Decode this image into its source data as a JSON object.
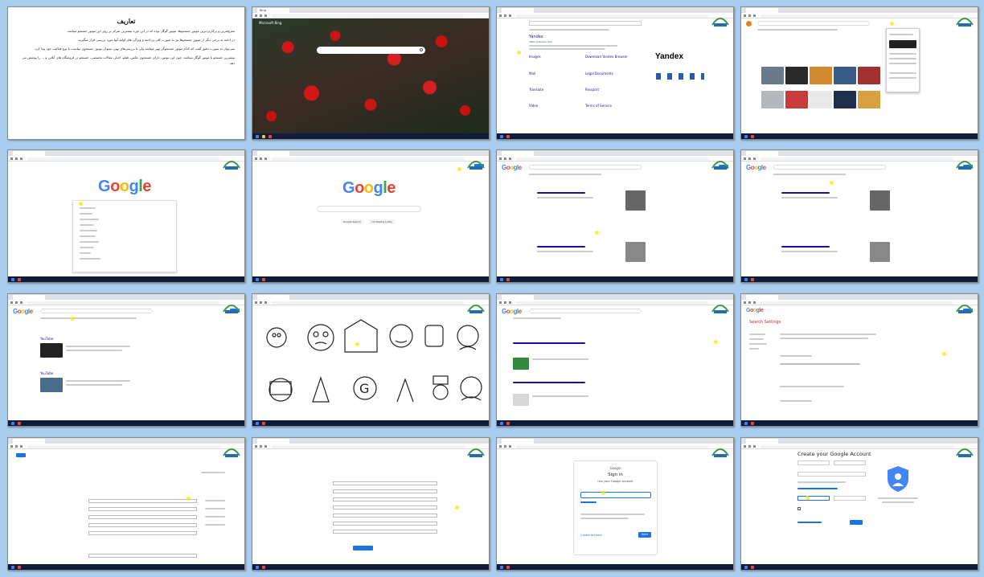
{
  "slide1": {
    "title": "تعاریف",
    "paragraphs": [
      "معروفترین و پرکاربردترین موتور جستجوها، موتور گوگل بوده که در این دوره بیشترین تمرکز بر روی این موتور جستجو میباشد.",
      "در ادامه به برخی دیگر از موتور جستجوها نیز به صورت کلی پرداخته و ویژگی های اولیه آنها مورد بررسی قرار میگیرند.",
      "نمی‌توان به صورت دقیق گفت که کدام موتور جستجوگر بهتر میباشد ولی با بررسی‌های بهتر، میتوان موتور جستجوی مناسب با نوع فعالیت خود پیدا کرد.",
      "بیشترین جستجو با موتور گوگل میباشد. چون این موتور، دارای جستجوی عکس، فیلم، اخبار، مقالات تخصصی، جستجو در فروشگاه های آنلاین و ... را پوشش می دهد."
    ]
  },
  "tiles": {
    "bing_title": "Bing",
    "bing_brand": "Microsoft Bing",
    "yandex_title": "Yandex",
    "yandex_logo": "Yandex",
    "yandex_result_title": "Yandex",
    "yandex_link": "https://yandex.com",
    "yandex_sections": [
      "Images",
      "Download Yandex Browser",
      "Mail",
      "Legal Documents",
      "Translate",
      "Passport",
      "Video",
      "Terms of Service"
    ],
    "google_logo": "Google",
    "google_images_logo": "Google",
    "google_small_logo": "Google",
    "search_btn": "Google Search",
    "lucky_btn": "I'm Feeling Lucky",
    "search_settings": "Search Settings",
    "signin_title": "Sign in",
    "signin_sub": "Use your Google Account",
    "next": "Next",
    "create_account": "Create account",
    "create_title": "Create your Google Account",
    "youtube_result": "YouTube"
  },
  "taskbar": {
    "time": ""
  }
}
